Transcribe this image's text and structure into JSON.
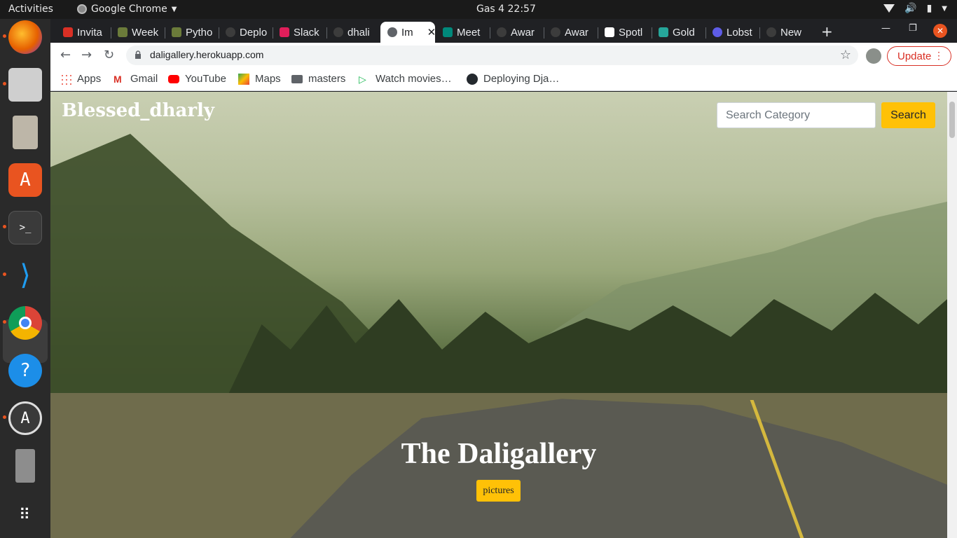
{
  "topbar": {
    "activities": "Activities",
    "app_name": "Google Chrome",
    "clock": "Gas 4  22:57"
  },
  "dock": {
    "items": [
      "firefox-icon",
      "files-icon",
      "archive-icon",
      "software-center-icon",
      "terminal-icon",
      "vscode-icon",
      "chrome-icon",
      "help-icon",
      "updater-icon",
      "usb-drive-icon",
      "apps-grid-icon"
    ]
  },
  "browser": {
    "tabs": [
      {
        "label": "Invita"
      },
      {
        "label": "Week"
      },
      {
        "label": "Pytho"
      },
      {
        "label": "Deplo"
      },
      {
        "label": "Slack"
      },
      {
        "label": "dhali"
      },
      {
        "label": "Im",
        "active": true
      },
      {
        "label": "Meet"
      },
      {
        "label": "Awar"
      },
      {
        "label": "Awar"
      },
      {
        "label": "Spotl"
      },
      {
        "label": "Gold"
      },
      {
        "label": "Lobst"
      },
      {
        "label": "New"
      }
    ],
    "url": "daligallery.herokuapp.com",
    "update_label": "Update",
    "bookmarks": [
      {
        "label": "Apps"
      },
      {
        "label": "Gmail"
      },
      {
        "label": "YouTube"
      },
      {
        "label": "Maps"
      },
      {
        "label": "masters"
      },
      {
        "label": "Watch movies…"
      },
      {
        "label": "Deploying Dja…"
      }
    ]
  },
  "page": {
    "brand": "Blessed_dharly",
    "search_placeholder": "Search Category",
    "search_button": "Search",
    "hero_title": "The Daligallery",
    "hero_badge": "pictures",
    "accent_color": "#ffc107"
  }
}
